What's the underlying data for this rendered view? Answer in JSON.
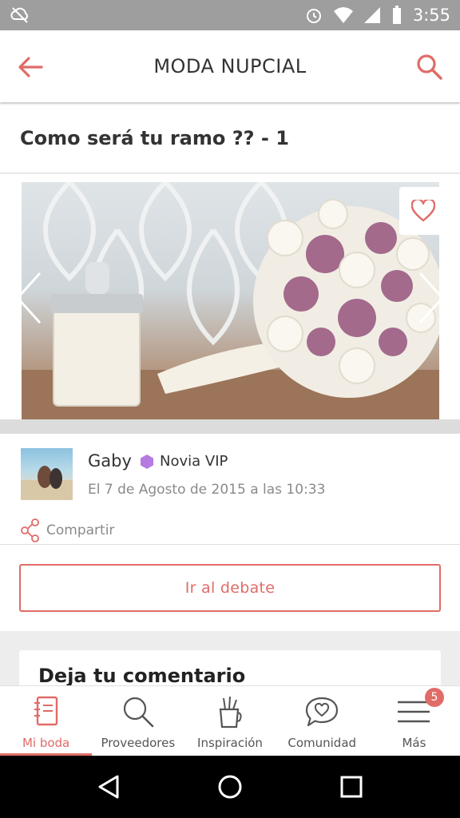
{
  "status_bar": {
    "time": "3:55"
  },
  "app_bar": {
    "title": "MODA NUPCIAL"
  },
  "post": {
    "title": "Como será tu ramo ?? - 1"
  },
  "author": {
    "name": "Gaby",
    "role": "Novia VIP",
    "date": "El 7 de Agosto de 2015 a las 10:33",
    "share_label": "Compartir"
  },
  "debate": {
    "button_label": "Ir al debate"
  },
  "comment": {
    "title": "Deja tu comentario"
  },
  "bottom_nav": {
    "items": [
      {
        "label": "Mi boda",
        "icon": "notebook-icon"
      },
      {
        "label": "Proveedores",
        "icon": "search-icon"
      },
      {
        "label": "Inspiración",
        "icon": "pencil-cup-icon"
      },
      {
        "label": "Comunidad",
        "icon": "chat-heart-icon"
      },
      {
        "label": "Más",
        "icon": "menu-icon",
        "badge": "5"
      }
    ]
  },
  "colors": {
    "accent": "#e06c68",
    "vip": "#b47be0"
  }
}
